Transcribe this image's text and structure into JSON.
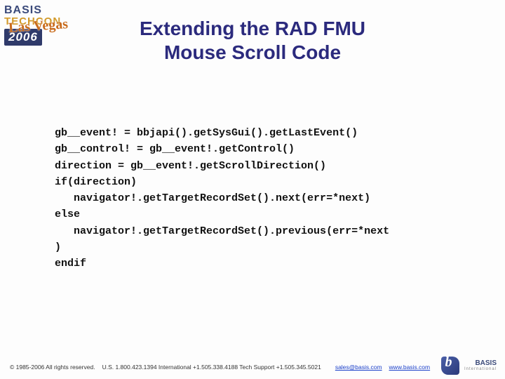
{
  "header": {
    "brand_top": "BASIS",
    "brand_mid": "TECHCON",
    "vegas": "Las Vegas",
    "year": "2006"
  },
  "title_line1": "Extending the RAD FMU",
  "title_line2": "Mouse Scroll Code",
  "code": [
    "gb__event! = bbjapi().getSysGui().getLastEvent()",
    "gb__control! = gb__event!.getControl()",
    "direction = gb__event!.getScrollDirection()",
    "if(direction)",
    "   navigator!.getTargetRecordSet().next(err=*next)",
    "else",
    "   navigator!.getTargetRecordSet().previous(err=*next",
    ")",
    "endif"
  ],
  "footer": {
    "copyright": "© 1985-2006 All rights reserved.",
    "phones": "U.S. 1.800.423.1394   International +1.505.338.4188   Tech Support +1.505.345.5021",
    "email": "sales@basis.com",
    "site": "www.basis.com",
    "logo_text": "BASIS",
    "logo_sub": "International"
  }
}
